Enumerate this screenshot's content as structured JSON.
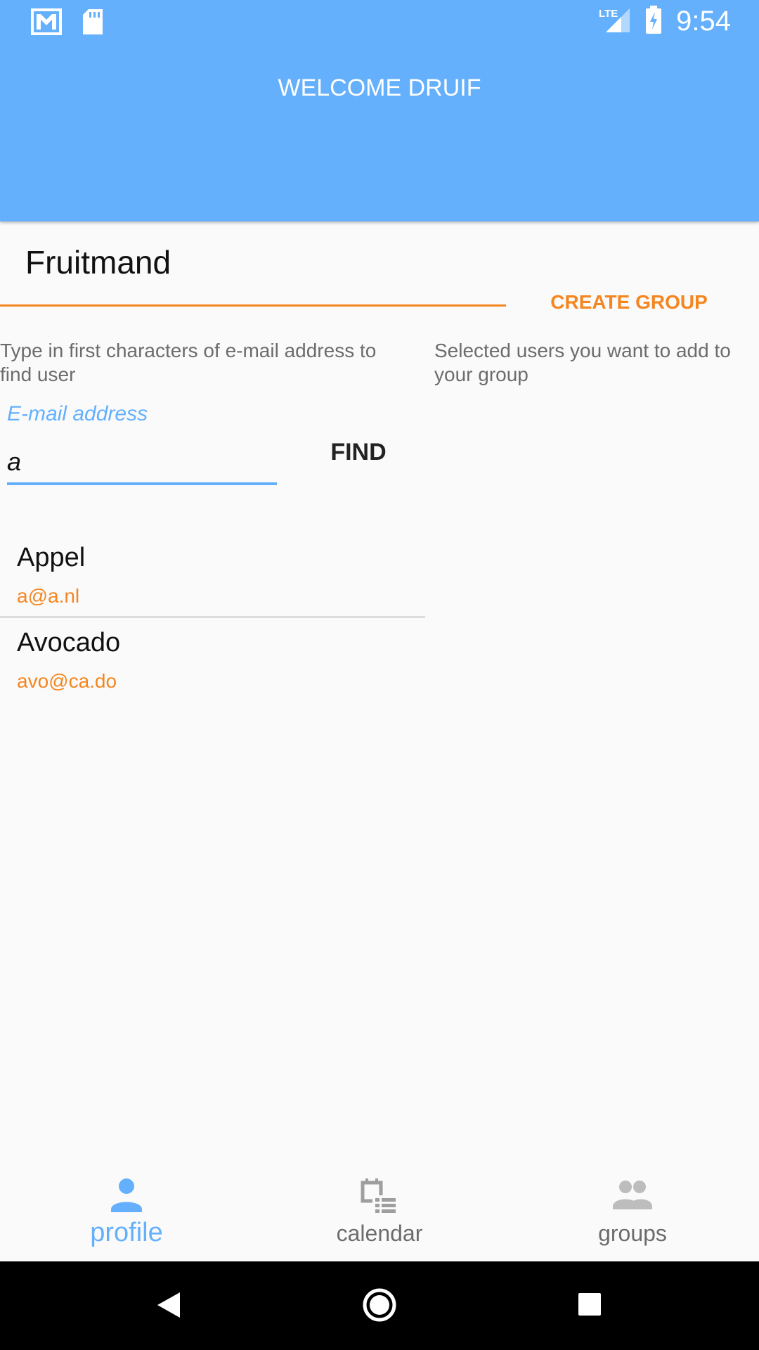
{
  "status_bar": {
    "time": "9:54",
    "network": "LTE",
    "left_icons": [
      "gmail-icon",
      "sd-card-icon"
    ],
    "right_icons": [
      "signal-icon",
      "battery-charging-icon"
    ]
  },
  "header": {
    "title": "WELCOME DRUIF",
    "background_color": "#64b0fc"
  },
  "group_form": {
    "group_name_value": "Fruitmand",
    "create_button_label": "CREATE GROUP",
    "accent_color": "#f5861f"
  },
  "search": {
    "hint": "Type in first characters of e-mail address to find user",
    "selected_hint": "Selected users you want to add to your group",
    "email_label": "E-mail address",
    "email_value": "a",
    "find_button_label": "FIND"
  },
  "results": [
    {
      "name": "Appel",
      "email": "a@a.nl"
    },
    {
      "name": "Avocado",
      "email": "avo@ca.do"
    }
  ],
  "bottom_nav": {
    "items": [
      {
        "label": "profile",
        "icon": "person-icon",
        "active": true
      },
      {
        "label": "calendar",
        "icon": "calendar-icon",
        "active": false
      },
      {
        "label": "groups",
        "icon": "group-icon",
        "active": false
      }
    ]
  },
  "system_nav": [
    "back-icon",
    "home-icon",
    "recents-icon"
  ]
}
